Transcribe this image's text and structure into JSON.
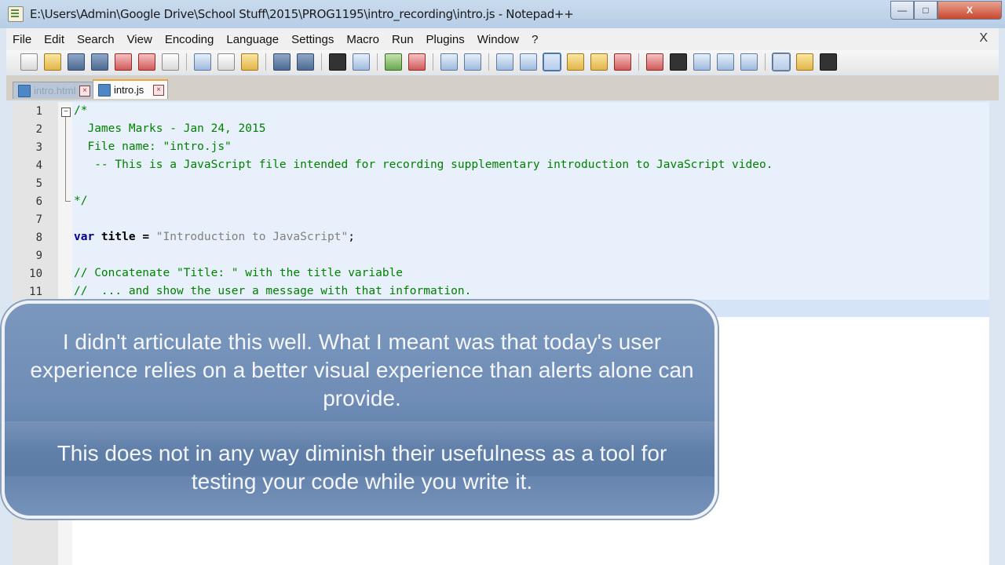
{
  "window": {
    "title": "E:\\Users\\Admin\\Google Drive\\School Stuff\\2015\\PROG1195\\intro_recording\\intro.js - Notepad++",
    "close_glyph": "X"
  },
  "menu": {
    "items": [
      "File",
      "Edit",
      "Search",
      "View",
      "Encoding",
      "Language",
      "Settings",
      "Macro",
      "Run",
      "Plugins",
      "Window",
      "?"
    ],
    "close_glyph": "X"
  },
  "tabs": [
    {
      "label": "intro.html",
      "active": false
    },
    {
      "label": "intro.js",
      "active": true
    }
  ],
  "editor": {
    "line_numbers": [
      "1",
      "2",
      "3",
      "4",
      "5",
      "6",
      "7",
      "8",
      "9",
      "10",
      "11"
    ],
    "lines": [
      "/*",
      "  James Marks - Jan 24, 2015",
      "  File name: \"intro.js\"",
      "   -- This is a JavaScript file intended for recording supplementary introduction to JavaScript video.",
      "",
      "*/",
      "",
      "var title = \"Introduction to JavaScript\";",
      "",
      "// Concatenate \"Title: \" with the title variable",
      "//  ... and show the user a message with that information."
    ],
    "line8": {
      "keyword": "var",
      "ident": " title ",
      "op": "=",
      "string": " \"Introduction to JavaScript\"",
      "end": ";"
    }
  },
  "overlay": {
    "paragraph1": "I didn't articulate this well. What I meant was that today's user experience relies on a better visual experience than alerts alone can provide.",
    "paragraph2": "This does not in any way diminish their usefulness as a tool for testing your code while you write it."
  },
  "colors": {
    "comment": "#008000",
    "keyword": "#00008b",
    "string": "#808080",
    "callout_bg": "#6f8db6"
  }
}
